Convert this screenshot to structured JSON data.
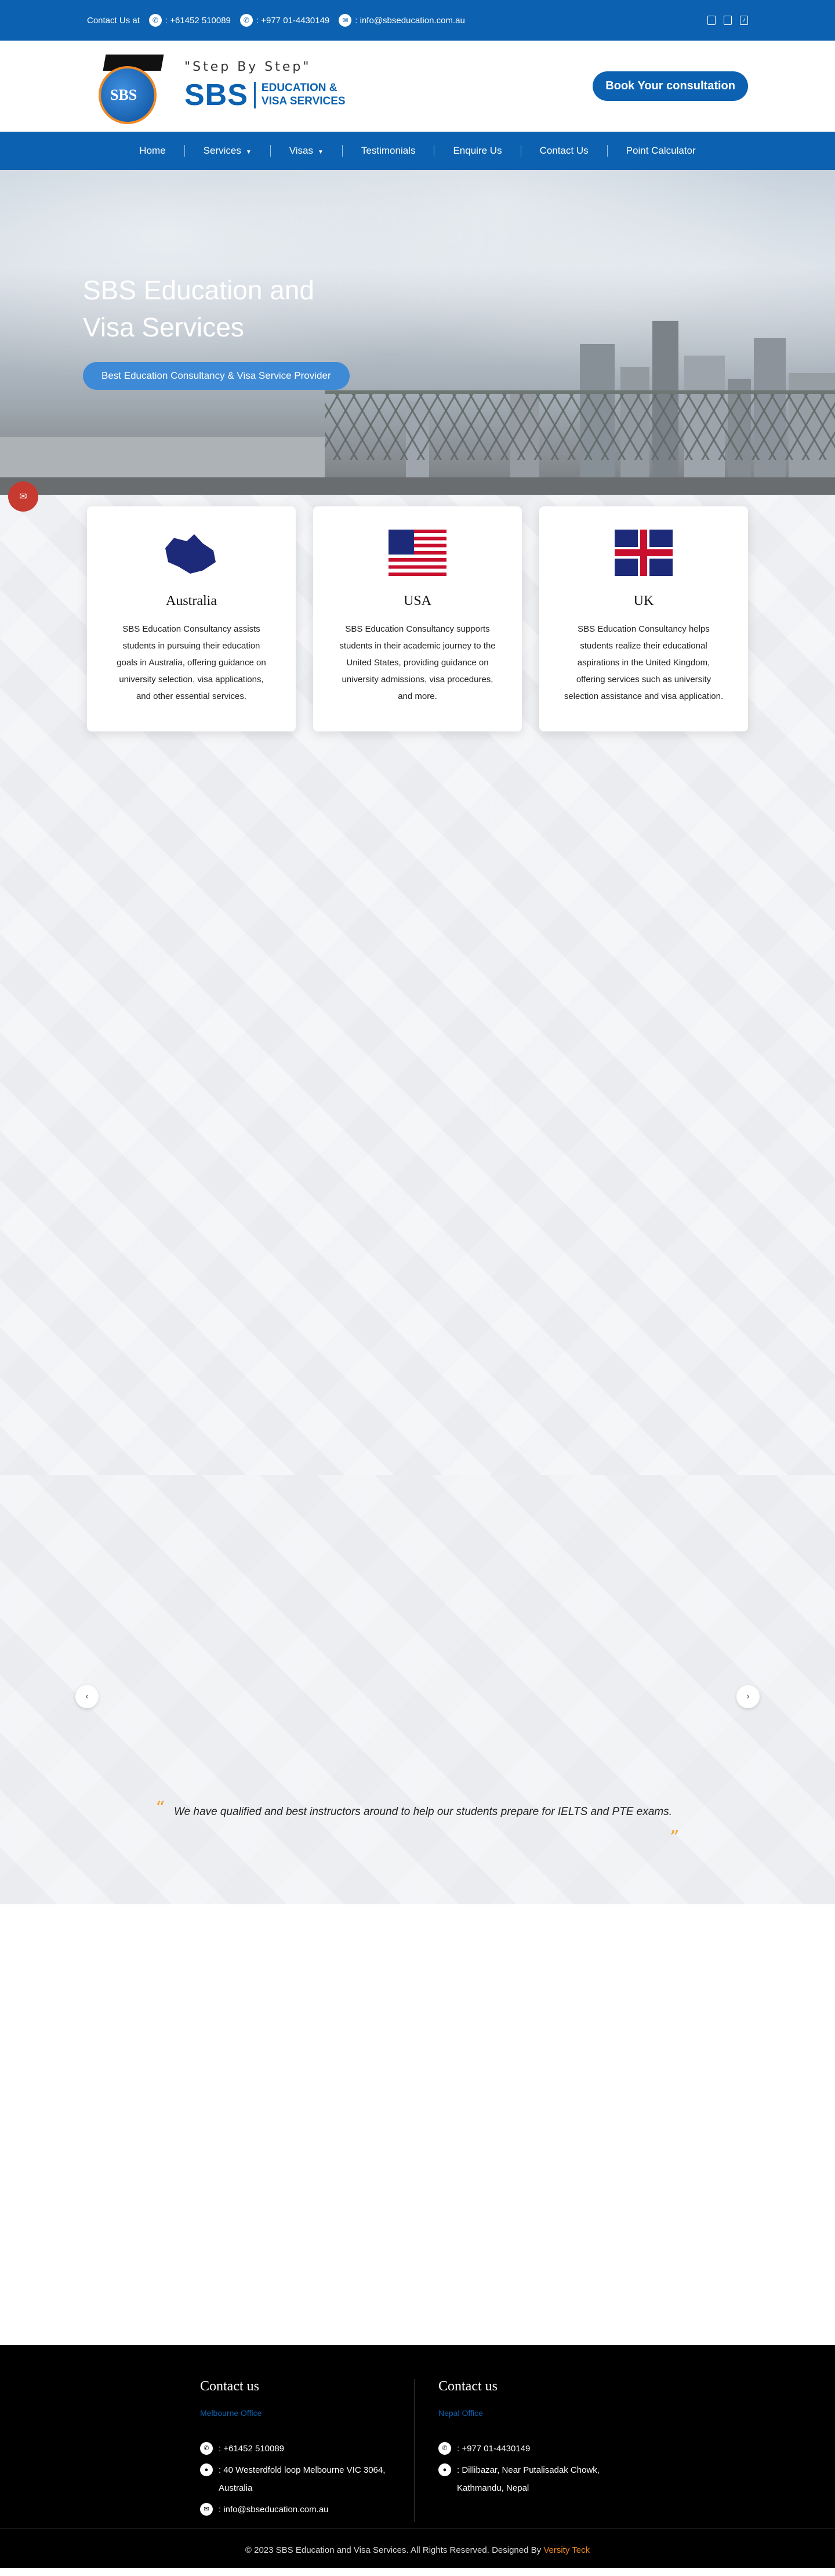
{
  "topbar": {
    "contact_label": "Contact Us at",
    "phone_au": ": +61452 510089",
    "phone_np": ": +977 01-4430149",
    "email": ": info@sbseducation.com.au",
    "social_icons": [
      "facebook-icon",
      "instagram-icon",
      "tiktok-icon"
    ]
  },
  "header": {
    "logo_tagline": "\"Step By Step\"",
    "logo_sbs": "SBS",
    "logo_globe_text": "SBS",
    "logo_sub_line1": "EDUCATION &",
    "logo_sub_line2": "VISA SERVICES",
    "cta": "Book Your consultation"
  },
  "nav": {
    "items": [
      "Home",
      "Services",
      "Visas",
      "Testimonials",
      "Enquire Us",
      "Contact Us",
      "Point Calculator"
    ]
  },
  "hero": {
    "title": "SBS Education and Visa Services",
    "button": "Best Education Consultancy & Visa Service Provider"
  },
  "countries": [
    {
      "name": "Australia",
      "text": "SBS Education Consultancy assists students in pursuing their education goals in Australia, offering guidance on university selection, visa applications, and other essential services."
    },
    {
      "name": "USA",
      "text": "SBS Education Consultancy supports students in their academic journey to the United States, providing guidance on university admissions, visa procedures, and more."
    },
    {
      "name": "UK",
      "text": "SBS Education Consultancy helps students realize their educational aspirations in the United Kingdom, offering services such as university selection assistance and visa application."
    }
  ],
  "testimonial": {
    "quote": "We have qualified and best instructors around to help our students prepare for IELTS and PTE exams."
  },
  "footer": {
    "col1": {
      "title": "Contact us",
      "office": "Melbourne Office",
      "phone": ": +61452 510089",
      "address": ": 40 Westerdfold loop Melbourne VIC 3064, Australia",
      "email": ": info@sbseducation.com.au"
    },
    "col2": {
      "title": "Contact us",
      "office": "Nepal Office",
      "phone": ": +977 01-4430149",
      "address": ": Dillibazar, Near Putalisadak Chowk, Kathmandu, Nepal"
    },
    "copyright": "© 2023 SBS Education and Visa Services. All Rights Reserved. Designed By",
    "designer": "Versity Teck"
  },
  "colors": {
    "primary": "#0c62b1",
    "accent": "#f08a24",
    "float": "#c63a30"
  }
}
